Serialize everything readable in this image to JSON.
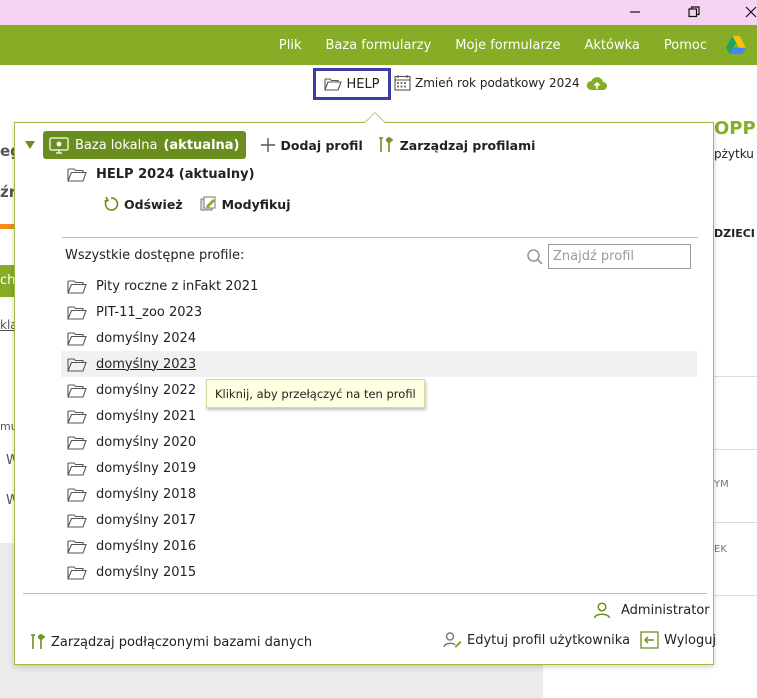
{
  "colors": {
    "accent": "#86ad25",
    "accent_dark": "#6a8e1e",
    "highlight_border": "#3b3fa5",
    "titlebar": "#f7d3f3"
  },
  "menubar": {
    "items": [
      "Plik",
      "Baza formularzy",
      "Moje formularze",
      "Aktówka",
      "Pomoc"
    ]
  },
  "toolbar": {
    "help_label": "HELP",
    "year_label": "Zmień rok podatkowy 2024"
  },
  "background": {
    "left_fragments": [
      "eg",
      "źr",
      "cho",
      "kla",
      "mu",
      "W",
      "W"
    ],
    "right_fragments": [
      "OPP",
      "pżytku",
      "DZIECI",
      "YM",
      "EK"
    ]
  },
  "dropdown": {
    "local_base_label": "Baza lokalna",
    "local_base_status": "(aktualna)",
    "add_profile": "Dodaj profil",
    "manage_profiles": "Zarządzaj profilami",
    "current_profile": "HELP 2024 (aktualny)",
    "refresh": "Odśwież",
    "modify": "Modyfikuj",
    "all_profiles_label": "Wszystkie dostępne profile:",
    "search_placeholder": "Znajdź profil",
    "profiles": [
      "Pity roczne z inFakt 2021",
      "PIT-11_zoo 2023",
      "domyślny 2024",
      "domyślny 2023",
      "domyślny 2022",
      "domyślny 2021",
      "domyślny 2020",
      "domyślny 2019",
      "domyślny 2018",
      "domyślny 2017",
      "domyślny 2016",
      "domyślny 2015"
    ],
    "hovered_index": 3,
    "tooltip": "Kliknij, aby przełączyć na ten profil",
    "user": "Administrator",
    "manage_databases": "Zarządzaj podłączonymi bazami danych",
    "edit_user_profile": "Edytuj profil użytkownika",
    "logout": "Wyloguj"
  }
}
